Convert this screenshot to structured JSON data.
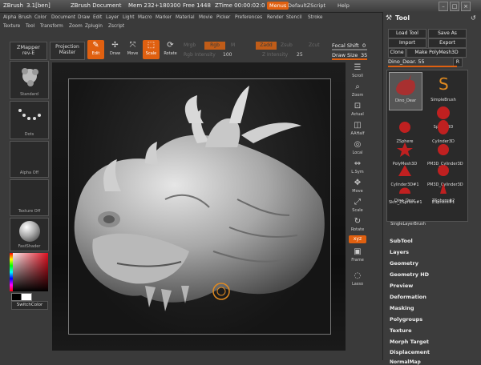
{
  "title": {
    "app": "ZBrush",
    "version": "3.1[ben]",
    "document": "ZBrush Document",
    "mem": "Mem 232+180300",
    "free": "Free 1448",
    "ztime": "ZTime 00:00:02:0",
    "menus": "Menus",
    "script": "DefaultZScript",
    "help": "Help"
  },
  "menubar": [
    "Alpha",
    "Brush",
    "Color",
    "Document",
    "Draw",
    "Edit",
    "Layer",
    "Light",
    "Macro",
    "Marker",
    "Material",
    "Movie",
    "Picker",
    "Preferences",
    "Render",
    "Stencil",
    "Stroke",
    "Texture",
    "Tool",
    "Transform",
    "Zoom",
    "Zplugin",
    "Zscript"
  ],
  "toolbar": {
    "zmapper": "ZMapper",
    "zmapper_sub": "rev-E",
    "projection": "Projection",
    "projection_sub": "Master",
    "edit": "Edit",
    "draw": "Draw",
    "move": "Move",
    "scale": "Scale",
    "rotate": "Rotate",
    "mrgb": "Mrgb",
    "rgb": "Rgb",
    "m": "M",
    "rgb_intensity_label": "Rgb Intensity",
    "rgb_intensity": "100",
    "zadd": "Zadd",
    "zsub": "Zsub",
    "zcut": "Zcut",
    "z_intensity_label": "Z Intensity",
    "z_intensity": "25",
    "focal_label": "Focal Shift",
    "focal_value": "0",
    "draw_size_label": "Draw Size",
    "draw_size_value": "35"
  },
  "leftshelf": {
    "brush": "Standard",
    "stroke": "Dots",
    "alpha": "Alpha Off",
    "texture": "Texture Off",
    "material": "FastShader",
    "switchcolor": "SwitchColor"
  },
  "rightshelf": [
    "Scroll",
    "Zoom",
    "Actual",
    "AAHalf",
    "Local",
    "L.Sym",
    "Move",
    "Scale",
    "Rotate",
    "",
    "Frame",
    "",
    "Lasso"
  ],
  "panel": {
    "title": "Tool",
    "load": "Load Tool",
    "save": "Save As",
    "import": "Import",
    "export": "Export",
    "clone": "Clone",
    "make": "Make PolyMesh3D",
    "current": "Dino_Dear. 55",
    "r": "R",
    "thumbs": [
      "Dino_Dear",
      "SimpleBrush",
      "",
      "Sphere3D",
      "ZSphere",
      "Cylinder3D",
      "PolyMesh3D",
      "PM3D_Cylinder3D",
      "Cylinder3D#1",
      "PM3D_Cylinder3D",
      "Skin_ZSphere#1",
      "ZSphere#1",
      "Dino_Dear",
      "ZSphere#2",
      "SingleLayerBrush"
    ],
    "sections": [
      "SubTool",
      "Layers",
      "Geometry",
      "Geometry HD",
      "Preview",
      "Deformation",
      "Masking",
      "Polygroups",
      "Texture",
      "Morph Target",
      "Displacement",
      "NormalMap"
    ]
  },
  "colors": {
    "accent": "#e06010"
  }
}
